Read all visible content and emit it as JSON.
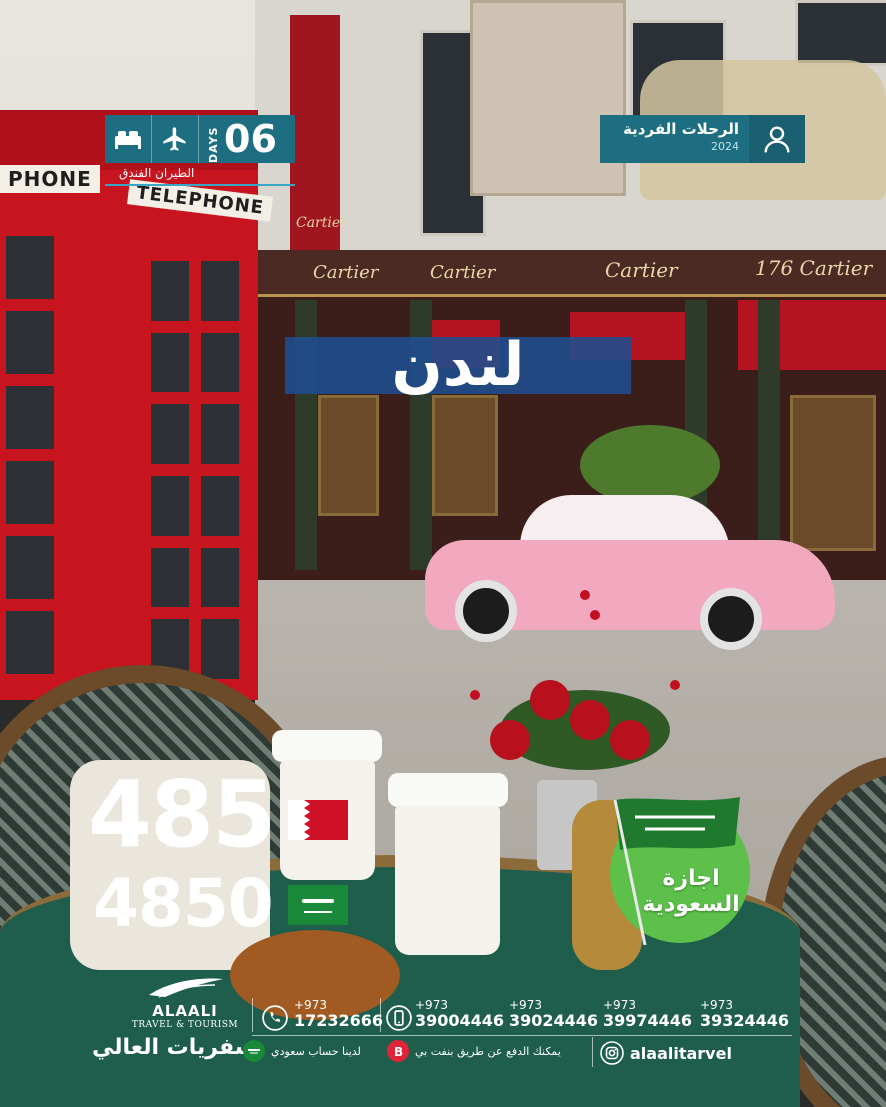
{
  "trip_tag": {
    "title": "الرحلات الفردية",
    "year": "2024",
    "icon": "user-icon"
  },
  "duration_tag": {
    "days_label": "DAYS",
    "days_count": "06",
    "includes_text": "الطيران الفندق",
    "icons": [
      "plane-icon",
      "bed-icon"
    ]
  },
  "destination": {
    "city": "لندن"
  },
  "scene_text": {
    "phone_box_top": "PHONE",
    "phone_box_front": "TELEPHONE",
    "store_sign_1": "Cartier",
    "store_sign_2": "Cartier",
    "store_sign_3": "Cartier",
    "store_sign_4": "176 Cartier",
    "banner_sign": "Cartier"
  },
  "pricing": {
    "bahrain_price": "485",
    "saudi_price": "4850",
    "flags": [
      "bahrain-flag",
      "saudi-flag"
    ]
  },
  "saudi_badge": {
    "line1": "اجازة",
    "line2": "السعودية"
  },
  "footer": {
    "logo_en": "ALAALI",
    "logo_en_sub": "TRAVEL & TOURISM",
    "logo_ar": "سفريات العالي",
    "phones": [
      {
        "prefix": "+973",
        "number": "17232666",
        "icon": "phone-icon"
      },
      {
        "prefix": "+973",
        "number": "39004446",
        "icon": "mobile-icon"
      },
      {
        "prefix": "+973",
        "number": "39024446"
      },
      {
        "prefix": "+973",
        "number": "39974446"
      },
      {
        "prefix": "+973",
        "number": "39324446"
      }
    ],
    "saudi_account": "لدينا حساب سعودي",
    "benefit_pay": "يمكنك الدفع عن طريق بنفت بي",
    "instagram_handle": "alaalitarvel"
  },
  "colors": {
    "teal": "#1d6e80",
    "city_band": "#1f4f8f",
    "badge_green": "#5cc04a"
  }
}
